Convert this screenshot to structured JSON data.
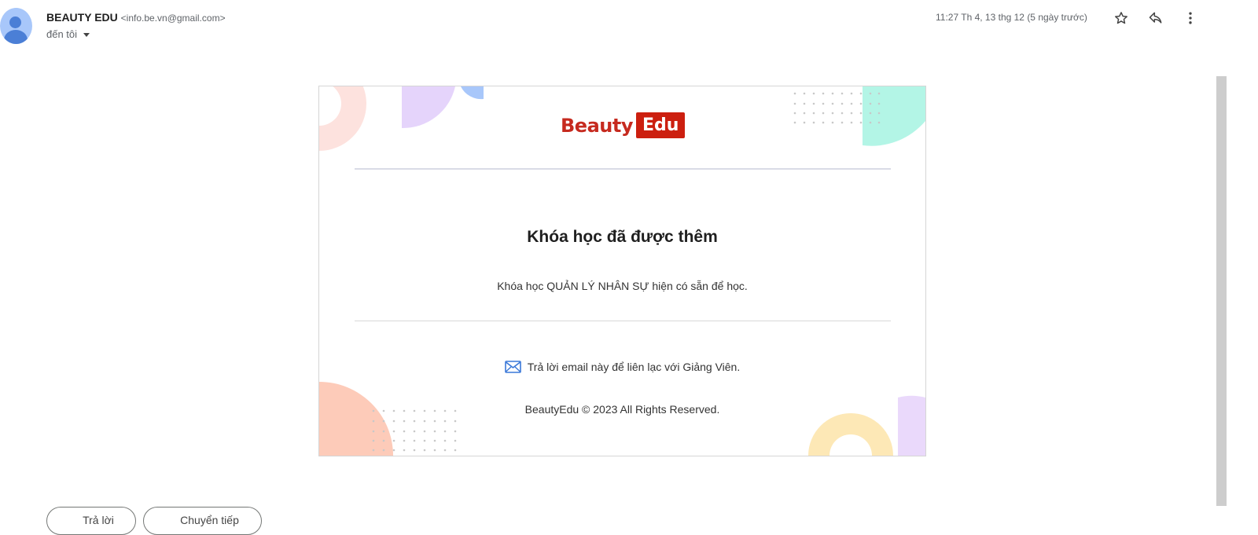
{
  "sender": {
    "name": "BEAUTY EDU",
    "email": "<info.be.vn@gmail.com>",
    "to_label": "đến tôi"
  },
  "timestamp": "11:27 Th 4, 13 thg 12 (5 ngày trước)",
  "header_icons": [
    "star-icon",
    "reply-icon",
    "more-vert-icon"
  ],
  "email": {
    "logo_part1": "Beauty",
    "logo_part2": "Edu",
    "title": "Khóa học đã được thêm",
    "body": "Khóa học QUẢN LÝ NHÂN SỰ hiện có sẵn để học.",
    "contact": "Trả lời email này để liên lạc với Giảng Viên.",
    "footer": "BeautyEdu © 2023 All Rights Reserved.",
    "brand_color": "#cc1f0f"
  },
  "actions": {
    "reply": "Trả lời",
    "forward": "Chuyển tiếp"
  }
}
